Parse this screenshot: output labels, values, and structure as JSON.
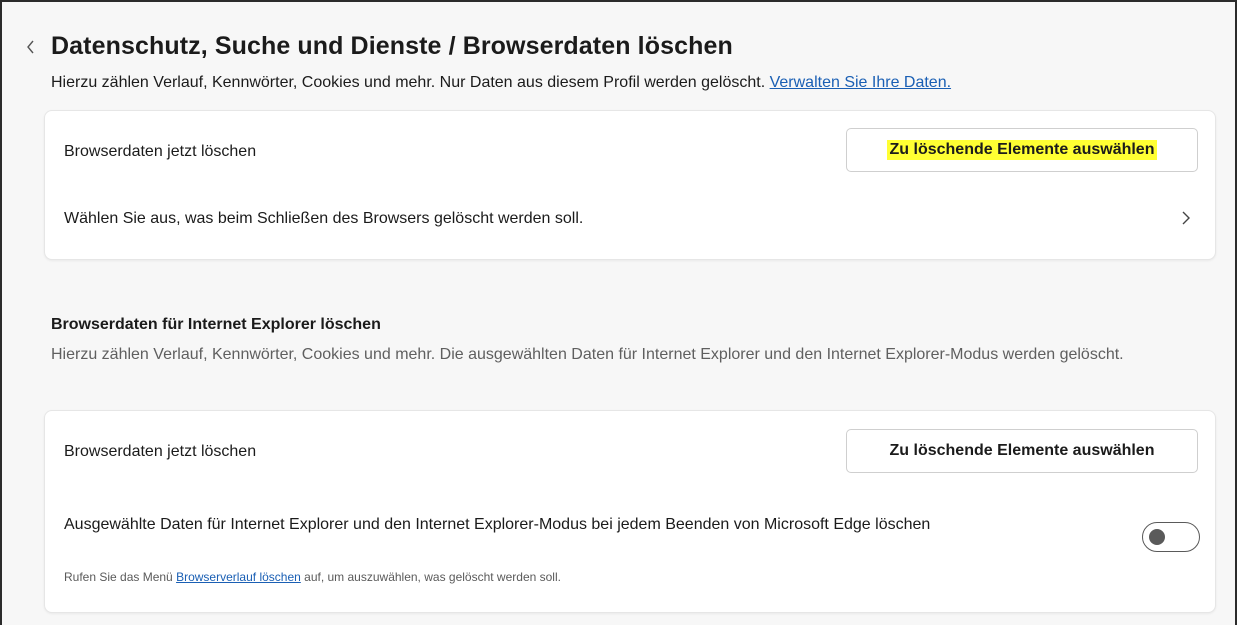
{
  "header": {
    "title": "Datenschutz, Suche und Dienste / Browserdaten löschen",
    "description": "Hierzu zählen Verlauf, Kennwörter, Cookies und mehr. Nur Daten aus diesem Profil werden gelöscht.",
    "manage_link": "Verwalten Sie Ihre Daten."
  },
  "card1": {
    "clear_now_label": "Browserdaten jetzt löschen",
    "choose_button": "Zu löschende Elemente auswählen",
    "on_close_label": "Wählen Sie aus, was beim Schließen des Browsers gelöscht werden soll."
  },
  "ie_section": {
    "title": "Browserdaten für Internet Explorer löschen",
    "description": "Hierzu zählen Verlauf, Kennwörter, Cookies und mehr. Die ausgewählten Daten für Internet Explorer und den Internet Explorer-Modus werden gelöscht."
  },
  "card2": {
    "clear_now_label": "Browserdaten jetzt löschen",
    "choose_button": "Zu löschende Elemente auswählen",
    "toggle_label": "Ausgewählte Daten für Internet Explorer und den Internet Explorer-Modus bei jedem Beenden von Microsoft Edge löschen",
    "hint_prefix": "Rufen Sie das Menü",
    "hint_link": "Browserverlauf löschen",
    "hint_suffix": "auf, um auszuwählen, was gelöscht werden soll.",
    "toggle_on": false
  },
  "colors": {
    "highlight": "#ffff33",
    "link": "#1a5fb4",
    "toggle_off": "#5a5a5a"
  },
  "icons": {
    "back": "chevron-left-icon",
    "row_arrow": "chevron-right-icon"
  }
}
